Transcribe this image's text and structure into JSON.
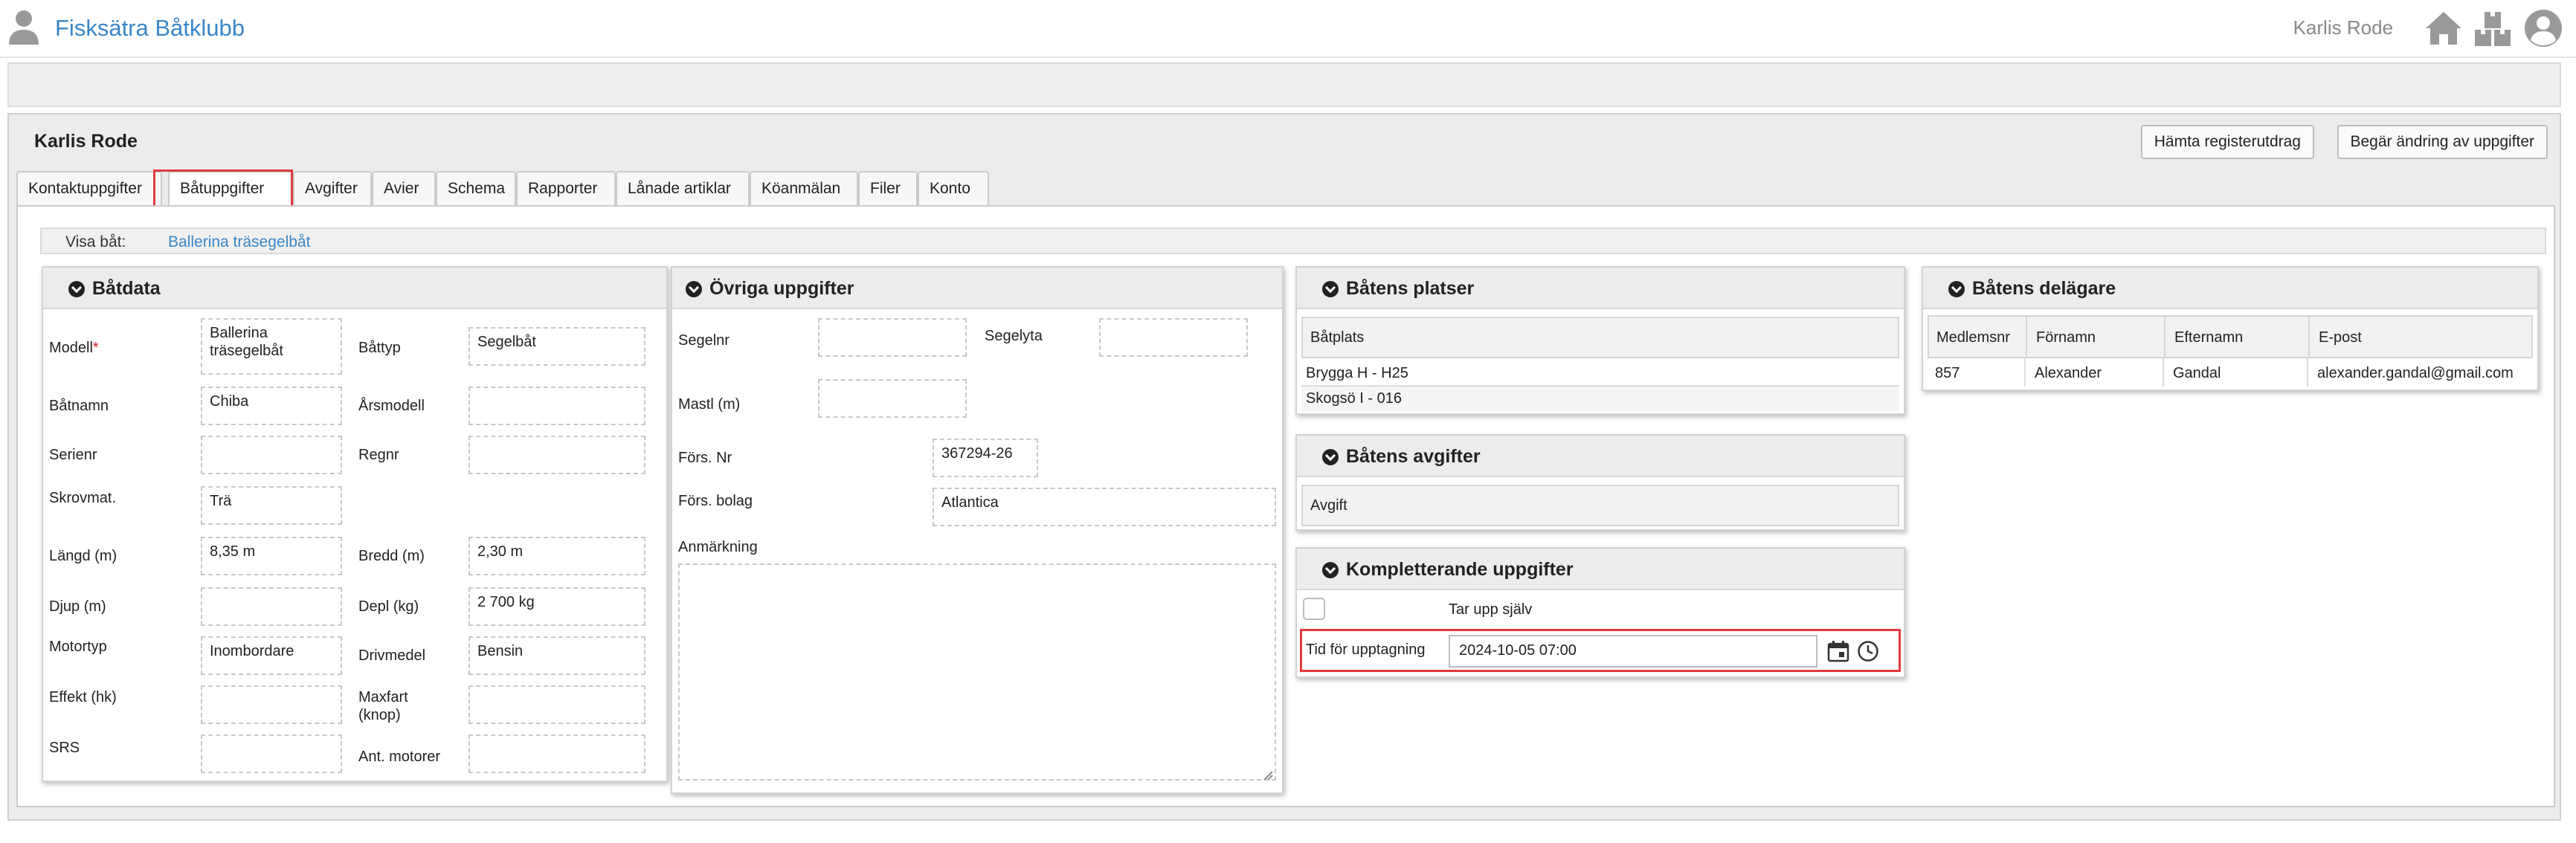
{
  "header": {
    "brand": "Fisksätra Båtklubb",
    "username": "Karlis Rode",
    "icons": [
      "user-icon",
      "home-icon",
      "boxes-icon",
      "account-icon"
    ]
  },
  "member": {
    "name": "Karlis Rode",
    "btn_register": "Hämta registerutdrag",
    "btn_request_change": "Begär ändring av uppgifter"
  },
  "tabs": [
    {
      "label": "Kontaktuppgifter"
    },
    {
      "label": "Båtuppgifter"
    },
    {
      "label": "Avgifter"
    },
    {
      "label": "Avier"
    },
    {
      "label": "Schema"
    },
    {
      "label": "Rapporter"
    },
    {
      "label": "Lånade artiklar"
    },
    {
      "label": "Köanmälan"
    },
    {
      "label": "Filer"
    },
    {
      "label": "Konto"
    }
  ],
  "active_tab": "Båtuppgifter",
  "visa_bat": {
    "label": "Visa båt:",
    "value": "Ballerina träsegelbåt"
  },
  "batdata": {
    "title": "Båtdata",
    "modell_label": "Modell",
    "required_mark": "*",
    "modell_value": "Ballerina träsegelbåt",
    "battyp_label": "Båttyp",
    "battyp_value": "Segelbåt",
    "batnamn_label": "Båtnamn",
    "batnamn_value": "Chiba",
    "arsmodell_label": "Årsmodell",
    "arsmodell_value": "",
    "serienr_label": "Serienr",
    "serienr_value": "",
    "regnr_label": "Regnr",
    "regnr_value": "",
    "skrovmat_label": "Skrovmat.",
    "skrovmat_value": "Trä",
    "langd_label": "Längd (m)",
    "langd_value": "8,35 m",
    "bredd_label": "Bredd (m)",
    "bredd_value": "2,30 m",
    "djup_label": "Djup (m)",
    "djup_value": "",
    "depl_label": "Depl (kg)",
    "depl_value": "2 700 kg",
    "motortyp_label": "Motortyp",
    "motortyp_value": "Inombordare",
    "drivmedel_label": "Drivmedel",
    "drivmedel_value": "Bensin",
    "effekt_label": "Effekt (hk)",
    "effekt_value": "",
    "maxfart_label": "Maxfart (knop)",
    "maxfart_value": "",
    "srs_label": "SRS",
    "srs_value": "",
    "antmotorer_label": "Ant. motorer",
    "antmotorer_value": ""
  },
  "ovriga": {
    "title": "Övriga uppgifter",
    "segelnr_label": "Segelnr",
    "segelnr_value": "",
    "segelyta_label": "Segelyta",
    "segelyta_value": "",
    "mastl_label": "Mastl (m)",
    "mastl_value": "",
    "forsnr_label": "Förs. Nr",
    "forsnr_value": "367294-26",
    "forsbolag_label": "Förs. bolag",
    "forsbolag_value": "Atlantica",
    "anmarkning_label": "Anmärkning",
    "anmarkning_value": ""
  },
  "platser": {
    "title": "Båtens platser",
    "column": "Båtplats",
    "rows": [
      "Brygga H - H25",
      "Skogsö I - 016"
    ]
  },
  "avgifter": {
    "title": "Båtens avgifter",
    "column": "Avgift"
  },
  "kompletterande": {
    "title": "Kompletterande uppgifter",
    "tar_upp_label": "Tar upp själv",
    "tid_label": "Tid för upptagning",
    "tid_value": "2024-10-05 07:00"
  },
  "delagare": {
    "title": "Båtens delägare",
    "columns": [
      "Medlemsnr",
      "Förnamn",
      "Efternamn",
      "E-post"
    ],
    "rows": [
      [
        "857",
        "Alexander",
        "Gandal",
        "alexander.gandal@gmail.com"
      ]
    ]
  },
  "colors": {
    "brand": "#3a86c8",
    "highlight": "#e03a3a",
    "required": "#d0202a"
  }
}
